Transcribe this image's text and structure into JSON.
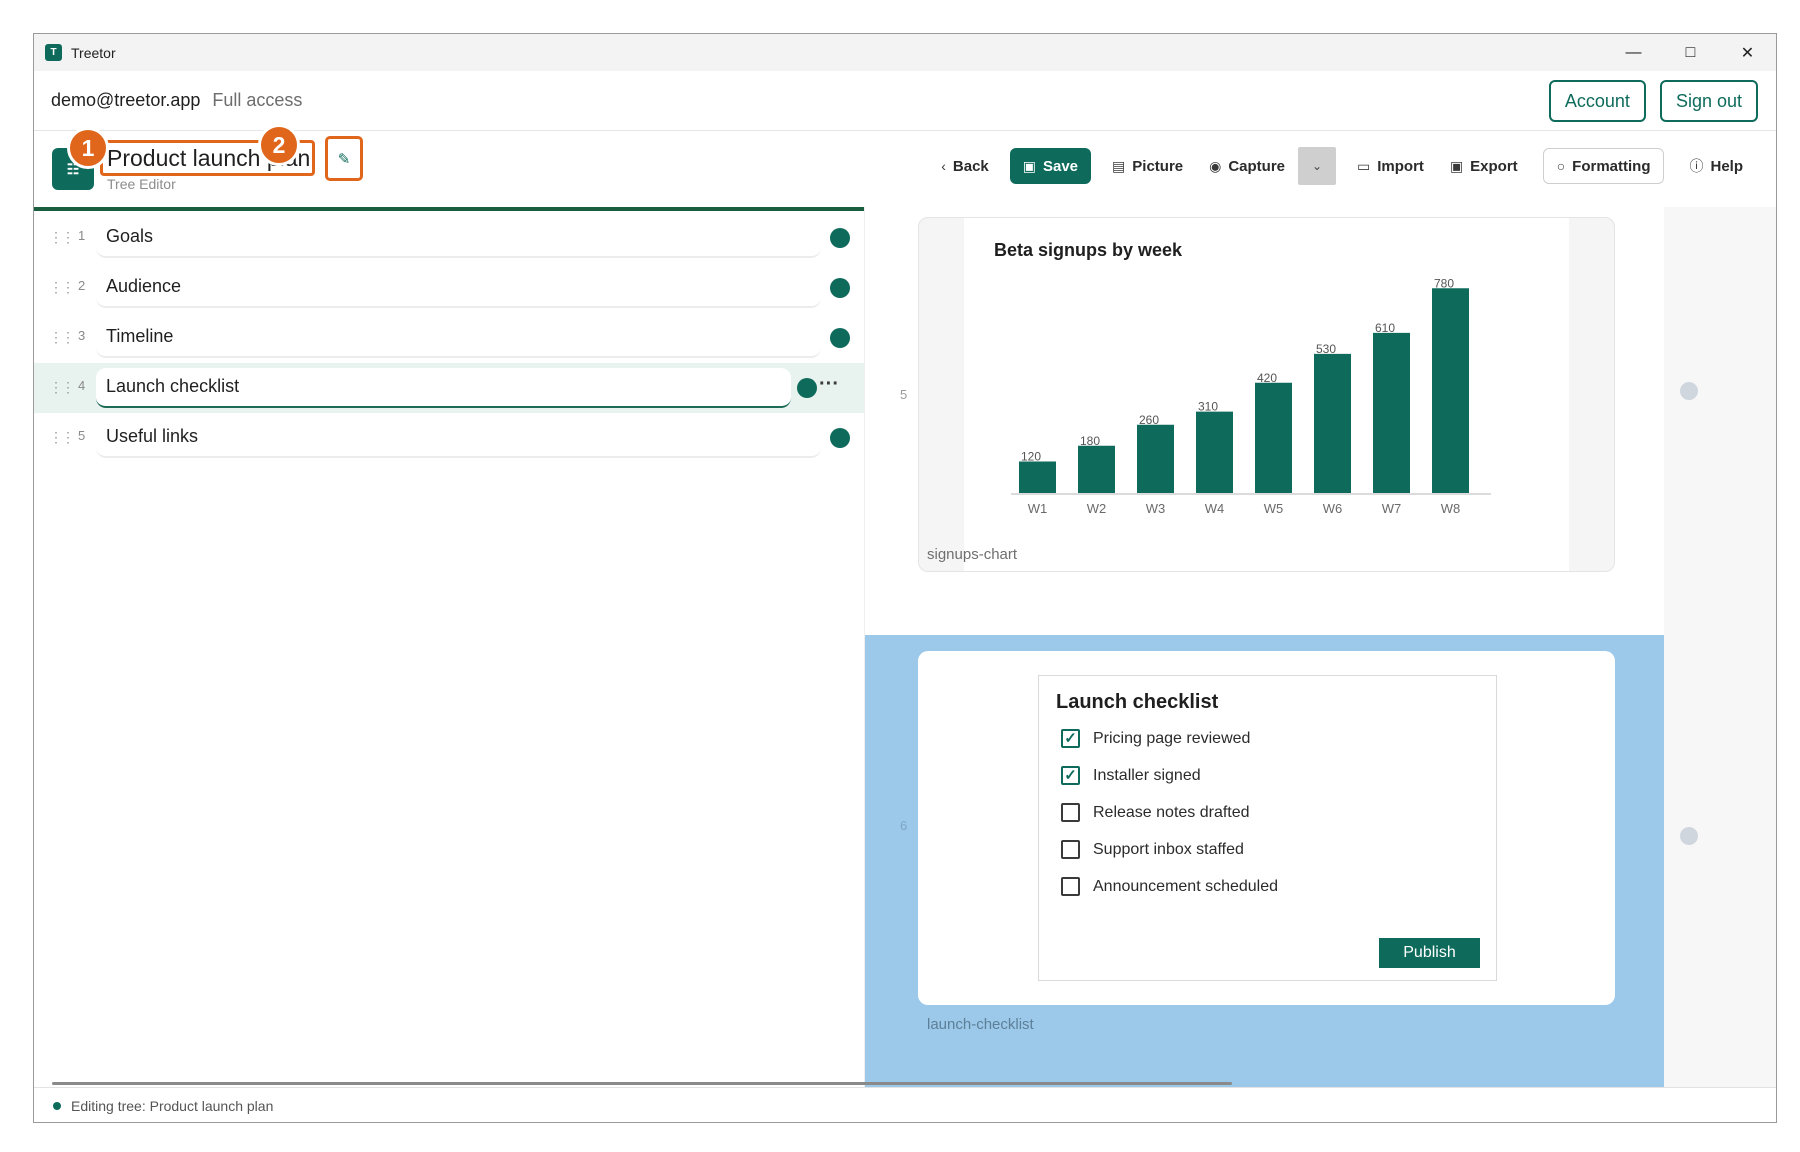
{
  "window": {
    "title": "Treetor"
  },
  "account": {
    "email": "demo@treetor.app",
    "access": "Full access",
    "account_label": "Account",
    "signout_label": "Sign out"
  },
  "editor": {
    "doc_title": "Product launch plan",
    "doc_subtitle": "Tree Editor",
    "badges": [
      "1",
      "2"
    ]
  },
  "toolbar": {
    "back": "Back",
    "save": "Save",
    "picture": "Picture",
    "capture": "Capture",
    "import": "Import",
    "export": "Export",
    "formatting": "Formatting",
    "help": "Help"
  },
  "tree": {
    "items": [
      {
        "num": "1",
        "label": "Goals"
      },
      {
        "num": "2",
        "label": "Audience"
      },
      {
        "num": "3",
        "label": "Timeline"
      },
      {
        "num": "4",
        "label": "Launch checklist"
      },
      {
        "num": "5",
        "label": "Useful links"
      }
    ],
    "more_glyph": "···"
  },
  "preview": {
    "node5_num": "5",
    "node6_num": "6",
    "chart_caption": "signups-chart",
    "checklist_caption": "launch-checklist",
    "checklist": {
      "title": "Launch checklist",
      "items": [
        {
          "label": "Pricing page reviewed",
          "checked": true
        },
        {
          "label": "Installer signed",
          "checked": true
        },
        {
          "label": "Release notes drafted",
          "checked": false
        },
        {
          "label": "Support inbox staffed",
          "checked": false
        },
        {
          "label": "Announcement scheduled",
          "checked": false
        }
      ],
      "publish": "Publish"
    }
  },
  "chart_data": {
    "type": "bar",
    "title": "Beta signups by week",
    "categories": [
      "W1",
      "W2",
      "W3",
      "W4",
      "W5",
      "W6",
      "W7",
      "W8"
    ],
    "values": [
      120,
      180,
      260,
      310,
      420,
      530,
      610,
      780
    ],
    "ylim": [
      0,
      800
    ],
    "bar_color": "#0e6b5c",
    "grid": false
  },
  "status": {
    "text": "Editing tree: Product launch plan"
  },
  "colors": {
    "accent": "#0e6b5c",
    "highlight": "#e0661c",
    "selection_blue": "#9cc9ea"
  }
}
